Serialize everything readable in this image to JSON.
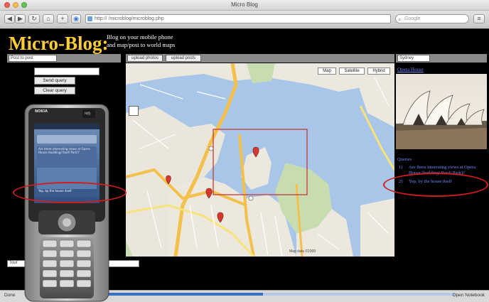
{
  "window": {
    "title": "Micro Blog"
  },
  "toolbar": {
    "url": "http://                                 /microblog/microblog.php",
    "search_placeholder": "Google"
  },
  "header": {
    "logo": "Micro-Blog:",
    "tagline_line1": "Blog on your mobile phone",
    "tagline_line2": "and map/post to world maps"
  },
  "controls": {
    "user_select": "Post to post",
    "map_button_1": "upload photos",
    "map_button_2": "upload posts",
    "right_select": "Sydney",
    "left_button_1": "Send query",
    "left_button_2": "Clear query"
  },
  "map": {
    "tabs": [
      "Map",
      "Satellite",
      "Hybrid"
    ],
    "credits": "Map data ©2009"
  },
  "right_panel": {
    "link": "Opera House",
    "list_heading": "Queries",
    "items": [
      {
        "num": "1)",
        "text": "Are there interesting views at Opera House (building/ Roof/ Park)?"
      },
      {
        "num": "2)",
        "text": "Yep, by the house itself"
      }
    ]
  },
  "phone": {
    "brand": "NOKIA",
    "model": "N95",
    "screen_item_1": "Are there interesting views at Opera House (building/ Roof/ Park)?",
    "screen_item_2": "Yep, by the house itself"
  },
  "bottom": {
    "label": "Tour"
  },
  "status": {
    "left": "Done",
    "right": "Open Notebook",
    "progress": 0.55
  },
  "colors": {
    "logo": "#ffcc33",
    "link": "#6f8cff",
    "highlight": "#d21d1d",
    "page_bg": "#000000"
  }
}
